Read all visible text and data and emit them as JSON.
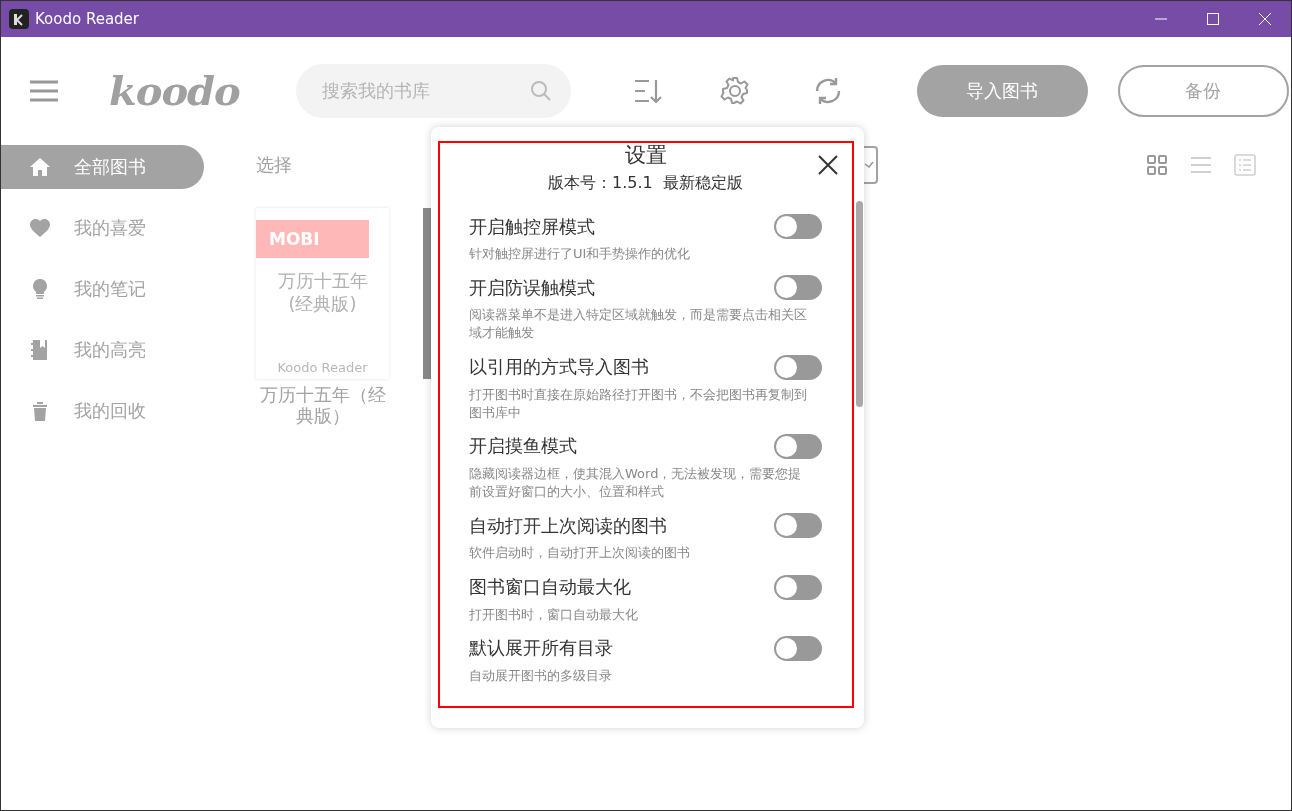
{
  "window": {
    "title": "Koodo Reader"
  },
  "header": {
    "logo": "koodo",
    "search": {
      "placeholder": "搜索我的书库"
    },
    "buttons": [
      {
        "label": "导入图书",
        "kind": "filled"
      },
      {
        "label": "备份",
        "kind": "outline"
      }
    ]
  },
  "sidebar": {
    "items": [
      {
        "label": "全部图书",
        "selected": true
      },
      {
        "label": "我的喜爱",
        "selected": false
      },
      {
        "label": "我的笔记",
        "selected": false
      },
      {
        "label": "我的高亮",
        "selected": false
      },
      {
        "label": "我的回收",
        "selected": false
      }
    ]
  },
  "library": {
    "select_label": "选择",
    "view_modes": [
      {
        "selected": true
      },
      {
        "selected": false
      },
      {
        "selected": false
      }
    ],
    "books": [
      {
        "kind": "generated",
        "format": "MOBI",
        "cover_title": "万历十五年(经典版)",
        "cover_brand": "Koodo Reader",
        "title": "万历十五年（经典版）"
      },
      {
        "kind": "photo"
      }
    ]
  },
  "settings_dialog": {
    "title": "设置",
    "version": "版本号：1.5.1  最新稳定版",
    "settings": [
      {
        "label": "开启触控屏模式",
        "description": "针对触控屏进行了UI和手势操作的优化",
        "on": false
      },
      {
        "label": "开启防误触模式",
        "description": "阅读器菜单不是进入特定区域就触发，而是需要点击相关区域才能触发",
        "on": false
      },
      {
        "label": "以引用的方式导入图书",
        "description": "打开图书时直接在原始路径打开图书，不会把图书再复制到图书库中",
        "on": false
      },
      {
        "label": "开启摸鱼模式",
        "description": "隐藏阅读器边框，使其混入Word，无法被发现，需要您提前设置好窗口的大小、位置和样式",
        "on": false
      },
      {
        "label": "自动打开上次阅读的图书",
        "description": "软件启动时，自动打开上次阅读的图书",
        "on": false
      },
      {
        "label": "图书窗口自动最大化",
        "description": "打开图书时，窗口自动最大化",
        "on": false
      },
      {
        "label": "默认展开所有目录",
        "description": "自动展开图书的多级目录",
        "on": false
      }
    ]
  }
}
